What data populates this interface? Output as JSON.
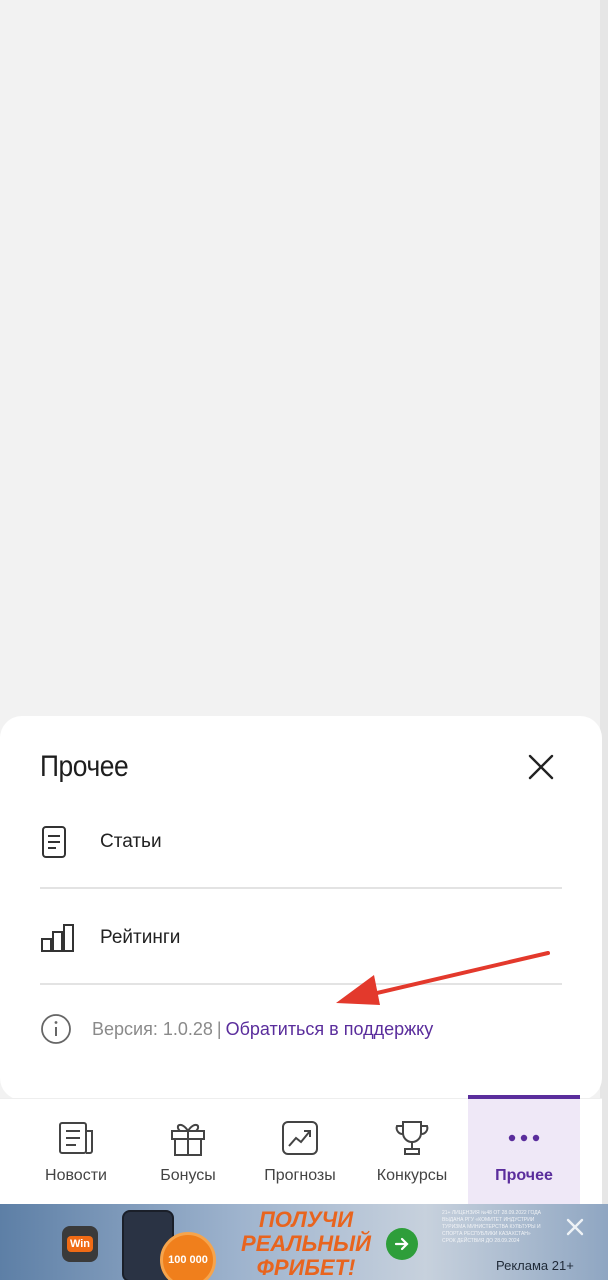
{
  "sheet": {
    "title": "Прочее",
    "close_icon": "close-icon",
    "items": [
      {
        "label": "Статьи",
        "icon": "article-icon"
      },
      {
        "label": "Рейтинги",
        "icon": "ratings-icon"
      }
    ],
    "version_text": "Версия: 1.0.28",
    "separator": "|",
    "support_link": "Обратиться в поддержку"
  },
  "tabbar": {
    "tabs": [
      {
        "label": "Новости",
        "icon": "news-icon",
        "active": false
      },
      {
        "label": "Бонусы",
        "icon": "gift-icon",
        "active": false
      },
      {
        "label": "Прогнозы",
        "icon": "chart-trend-icon",
        "active": false
      },
      {
        "label": "Конкурсы",
        "icon": "trophy-icon",
        "active": false
      },
      {
        "label": "Прочее",
        "icon": "more-dots-icon",
        "active": true
      }
    ]
  },
  "ad": {
    "logo_text": "Win",
    "coin_text": "100 000",
    "headline": "Получи реальный фрибет!",
    "fine_print": "21+ ЛИЦЕНЗИЯ №48 ОТ 28.09.2022 ГОДА ВЫДАНА РГУ «КОМИТЕТ ИНДУСТРИИ ТУРИЗМА МИНИСТЕРСТВА КУЛЬТУРЫ И СПОРТА РЕСПУБЛИКИ КАЗАХСТАН» СРОК ДЕЙСТВИЯ ДО 28.09.2024",
    "mark": "Реклама 21+"
  },
  "colors": {
    "accent": "#5a2d9c",
    "arrow": "#e3392c",
    "background": "#f2f2f2"
  }
}
